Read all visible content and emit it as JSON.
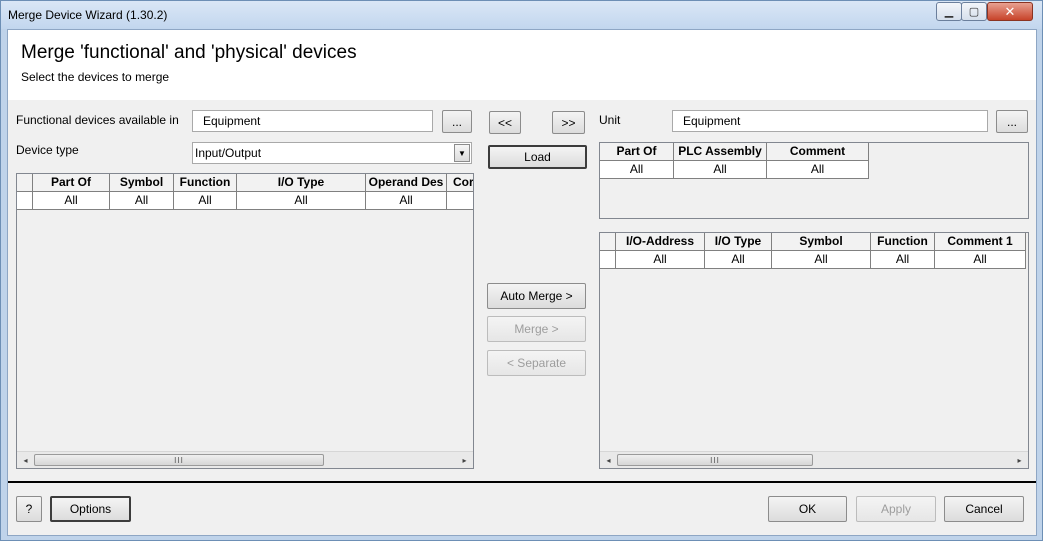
{
  "window": {
    "title": "Merge Device Wizard (1.30.2)",
    "min_glyph": "▁",
    "max_glyph": "▢",
    "close_glyph": "✕"
  },
  "header": {
    "title": "Merge 'functional' and 'physical' devices",
    "subtitle": "Select the devices to merge"
  },
  "left": {
    "available_label": "Functional devices available in",
    "available_value": "Equipment",
    "browse_label": "...",
    "device_type_label": "Device type",
    "device_type_value": "Input/Output",
    "table": {
      "headers": [
        "",
        "Part Of",
        "Symbol",
        "Function",
        "I/O Type",
        "Operand Des",
        "Cor"
      ],
      "filters": [
        "",
        "All",
        "All",
        "All",
        "All",
        "All",
        ""
      ]
    }
  },
  "middle": {
    "move_left_label": "<<",
    "move_right_label": ">>",
    "load_label": "Load",
    "auto_merge_label": "Auto Merge >",
    "merge_label": "Merge >",
    "separate_label": "< Separate"
  },
  "right": {
    "unit_label": "Unit",
    "unit_value": "Equipment",
    "browse_label": "...",
    "top_table": {
      "headers": [
        "Part Of",
        "PLC Assembly",
        "Comment"
      ],
      "filters": [
        "All",
        "All",
        "All"
      ]
    },
    "bottom_table": {
      "headers": [
        "",
        "I/O-Address",
        "I/O Type",
        "Symbol",
        "Function",
        "Comment 1"
      ],
      "filters": [
        "",
        "All",
        "All",
        "All",
        "All",
        "All"
      ]
    }
  },
  "scroll": {
    "left_arrow": "◂",
    "right_arrow": "▸",
    "thumb_grip": "III"
  },
  "footer": {
    "help_label": "?",
    "options_label": "Options",
    "ok_label": "OK",
    "apply_label": "Apply",
    "cancel_label": "Cancel"
  }
}
